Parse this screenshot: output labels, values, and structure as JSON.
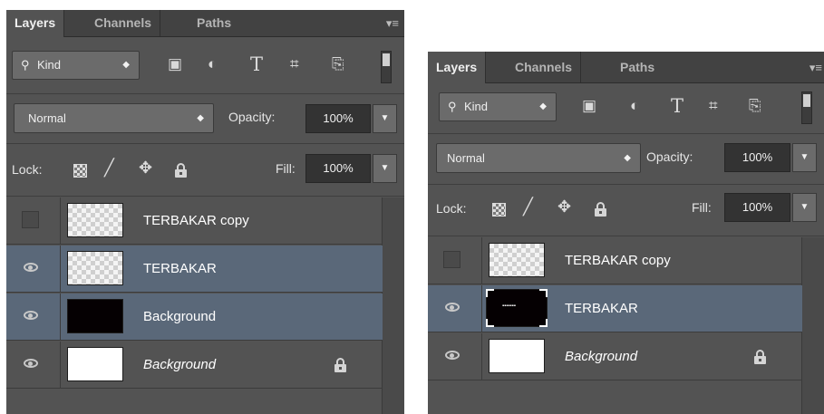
{
  "panels": [
    {
      "tabs": [
        "Layers",
        "Channels",
        "Paths"
      ],
      "menu_icon": "panel-menu-icon",
      "filter": {
        "label": "Kind",
        "icon": "search-icon",
        "arrows": "◆"
      },
      "filter_icons": [
        "image-filter-icon",
        "adjustment-filter-icon",
        "type-filter-icon",
        "shape-filter-icon",
        "smart-object-filter-icon"
      ],
      "blend_mode": "Normal",
      "opacity_label": "Opacity:",
      "opacity_value": "100%",
      "lock_label": "Lock:",
      "fill_label": "Fill:",
      "fill_value": "100%",
      "layers": [
        {
          "name": "TERBAKAR copy",
          "visible": false,
          "thumb": "transparent",
          "selected": false,
          "italic": false,
          "locked": false
        },
        {
          "name": "TERBAKAR",
          "visible": true,
          "thumb": "transparent",
          "selected": true,
          "italic": false,
          "locked": false
        },
        {
          "name": "Background",
          "visible": true,
          "thumb": "black",
          "selected": true,
          "italic": false,
          "locked": false
        },
        {
          "name": "Background",
          "visible": true,
          "thumb": "white",
          "selected": false,
          "italic": true,
          "locked": true
        }
      ]
    },
    {
      "tabs": [
        "Layers",
        "Channels",
        "Paths"
      ],
      "menu_icon": "panel-menu-icon",
      "filter": {
        "label": "Kind",
        "icon": "search-icon",
        "arrows": "◆"
      },
      "filter_icons": [
        "image-filter-icon",
        "adjustment-filter-icon",
        "type-filter-icon",
        "shape-filter-icon",
        "smart-object-filter-icon"
      ],
      "blend_mode": "Normal",
      "opacity_label": "Opacity:",
      "opacity_value": "100%",
      "lock_label": "Lock:",
      "fill_label": "Fill:",
      "fill_value": "100%",
      "layers": [
        {
          "name": "TERBAKAR copy",
          "visible": false,
          "thumb": "transparent",
          "selected": false,
          "italic": false,
          "locked": false
        },
        {
          "name": "TERBAKAR",
          "visible": true,
          "thumb": "black-text-mask",
          "selected": true,
          "italic": false,
          "locked": false
        },
        {
          "name": "Background",
          "visible": true,
          "thumb": "white",
          "selected": false,
          "italic": true,
          "locked": true
        }
      ]
    }
  ],
  "colors": {
    "panel_bg": "#535353",
    "selected_row": "#5a6879",
    "tab_bar": "#424242"
  }
}
